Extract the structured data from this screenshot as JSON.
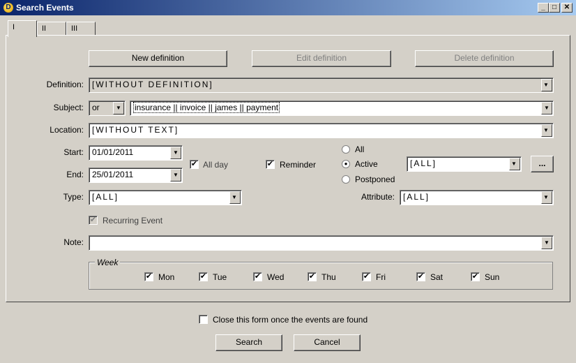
{
  "window": {
    "icon_letter": "D",
    "title": "Search Events",
    "min_glyph": "_",
    "max_glyph": "□",
    "close_glyph": "✕"
  },
  "tabs": [
    "I",
    "II",
    "III"
  ],
  "toolbar": {
    "new_label": "New definition",
    "edit_label": "Edit definition",
    "delete_label": "Delete definition"
  },
  "definition": {
    "label": "Definition:",
    "value": "[WITHOUT DEFINITION]"
  },
  "subject": {
    "label": "Subject:",
    "operator": "or",
    "value": "insurance || invoice || james || payment"
  },
  "location": {
    "label": "Location:",
    "value": "[WITHOUT TEXT]"
  },
  "start": {
    "label": "Start:",
    "value": "01/01/2011"
  },
  "end": {
    "label": "End:",
    "value": "25/01/2011"
  },
  "all_day": {
    "label": "All day",
    "checked": true
  },
  "reminder": {
    "label": "Reminder",
    "checked": true
  },
  "status": {
    "options": [
      "All",
      "Active",
      "Postponed"
    ],
    "selected": "Active",
    "value": "[ALL]",
    "more_label": "..."
  },
  "type": {
    "label": "Type:",
    "value": "[ALL]"
  },
  "attribute": {
    "label": "Attribute:",
    "value": "[ALL]"
  },
  "recurring": {
    "label": "Recurring Event",
    "checked": true
  },
  "note": {
    "label": "Note:",
    "value": ""
  },
  "week": {
    "legend": "Week",
    "days": [
      "Mon",
      "Tue",
      "Wed",
      "Thu",
      "Fri",
      "Sat",
      "Sun"
    ]
  },
  "close_form": {
    "label": "Close this form once the events are found",
    "checked": false
  },
  "actions": {
    "search_label": "Search",
    "cancel_label": "Cancel"
  },
  "glyphs": {
    "check": "✔",
    "radio_dot": "●",
    "dropdown": "▼"
  }
}
